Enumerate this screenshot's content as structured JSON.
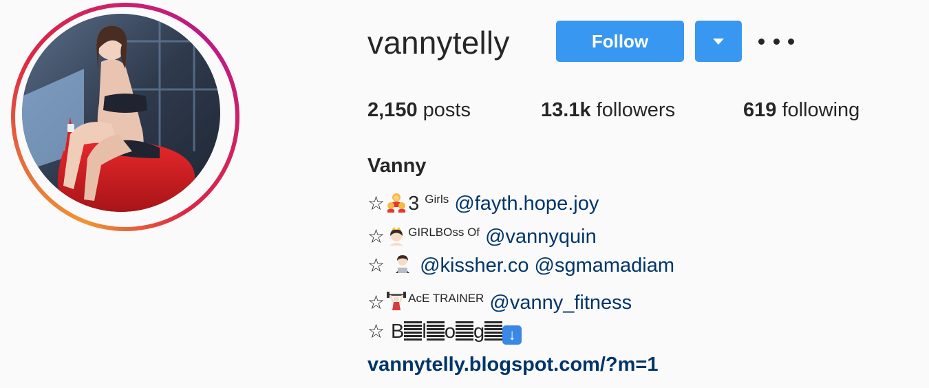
{
  "profile": {
    "username": "vannytelly",
    "follow_label": "Follow",
    "stats": {
      "posts_count": "2,150",
      "posts_label": " posts",
      "followers_count": "13.1k",
      "followers_label": " followers",
      "following_count": "619",
      "following_label": " following"
    },
    "full_name": "Vanny",
    "bio": {
      "line1": {
        "star": "☆",
        "text": "3 ",
        "sup": "Girls",
        "mention": "@fayth.hope.joy"
      },
      "line2": {
        "star": "☆",
        "sup": "GIRLBOss Of",
        "mention": "@vannyquin"
      },
      "line3": {
        "star": "☆ ",
        "mention1": "@kissher.co",
        "mention2": "@sgmamadiam"
      },
      "line4": {
        "star": "☆",
        "sup": "AcE TRAINER",
        "mention": "@vanny_fitness"
      },
      "line5": {
        "star": "☆ ",
        "letters": [
          "B",
          "l",
          "o",
          "g"
        ]
      }
    },
    "website": "vannytelly.blogspot.com/?m=1"
  },
  "icons": {
    "more": "more-options-icon",
    "dropdown": "chevron-down-icon"
  },
  "colors": {
    "follow_button": "#3897f0",
    "link": "#003569",
    "text": "#262626",
    "background": "#fafafa"
  }
}
